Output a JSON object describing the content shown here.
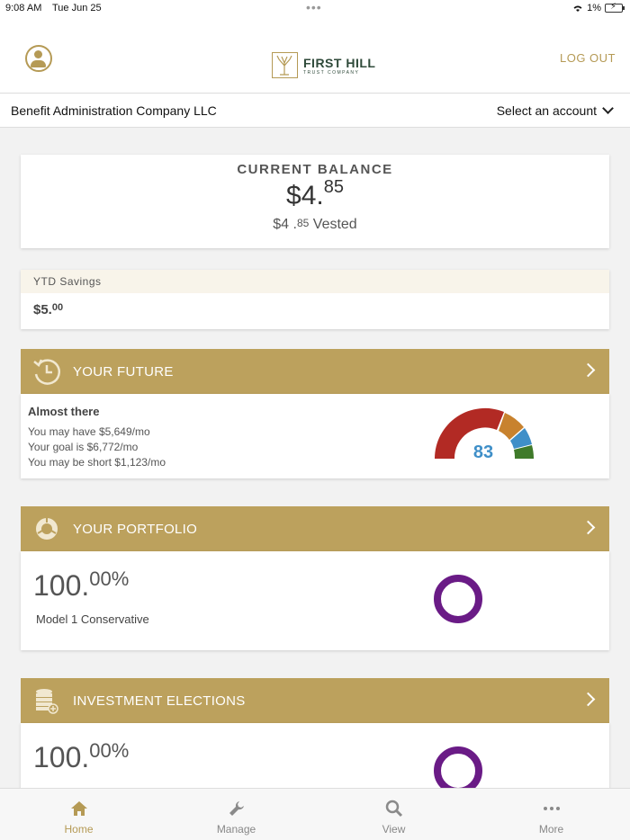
{
  "status_bar": {
    "time": "9:08 AM",
    "date": "Tue Jun 25",
    "battery": "1%"
  },
  "header": {
    "logo_name": "FIRST HILL",
    "logo_sub": "TRUST COMPANY",
    "logout_label": "LOG OUT"
  },
  "account_bar": {
    "company": "Benefit Administration Company LLC",
    "select_label": "Select an account"
  },
  "balance": {
    "title": "CURRENT BALANCE",
    "whole": "$4.",
    "cents": "85",
    "vested_whole": "$4 .",
    "vested_cents": "85",
    "vested_label": " Vested"
  },
  "ytd": {
    "label": "YTD Savings",
    "whole": "$5.",
    "cents": "00"
  },
  "future": {
    "title": "YOUR FUTURE",
    "status": "Almost there",
    "line1": "You may have $5,649/mo",
    "line2": "Your goal is $6,772/mo",
    "line3": "You may be short $1,123/mo",
    "score": "83"
  },
  "portfolio": {
    "title": "YOUR PORTFOLIO",
    "pct_whole": "100.",
    "pct_dec": "00%",
    "model": "Model 1 Conservative"
  },
  "investment": {
    "title": "INVESTMENT ELECTIONS",
    "pct_whole": "100.",
    "pct_dec": "00%"
  },
  "tabs": [
    {
      "label": "Home",
      "icon": "home-icon"
    },
    {
      "label": "Manage",
      "icon": "wrench-icon"
    },
    {
      "label": "View",
      "icon": "search-icon"
    },
    {
      "label": "More",
      "icon": "more-icon"
    }
  ],
  "colors": {
    "gold": "#bca15d",
    "purple": "#6a1b86",
    "gauge_red": "#b22a24",
    "gauge_orange": "#c8822e",
    "gauge_blue": "#3f8fc8",
    "gauge_green": "#3f7a2a"
  }
}
